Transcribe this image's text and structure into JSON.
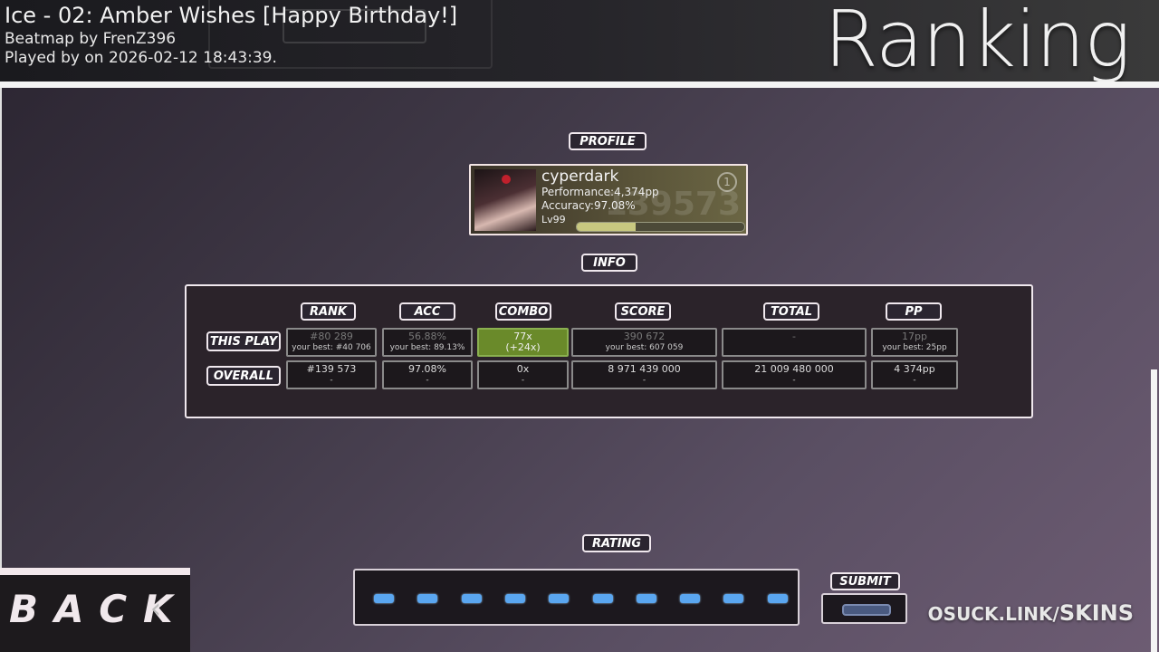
{
  "header": {
    "song_title": "Ice - 02: Amber Wishes [Happy Birthday!]",
    "beatmap_by": "Beatmap by FrenZ396",
    "played_by": "Played by  on 2026-02-12 18:43:39.",
    "screen_title": "Ranking"
  },
  "sections": {
    "profile": "PROFILE",
    "info": "INFO",
    "rating": "RATING",
    "submit": "SUBMIT"
  },
  "profile": {
    "username": "cyperdark",
    "performance": "Performance:4,374pp",
    "accuracy": "Accuracy:97.08%",
    "level": "Lv99",
    "level_progress": 0.35,
    "global_rank_bg": "139573",
    "country_rank": "1"
  },
  "info": {
    "columns": [
      "RANK",
      "ACC",
      "COMBO",
      "SCORE",
      "TOTAL",
      "PP"
    ],
    "rows": [
      "THIS PLAY",
      "OVERALL"
    ],
    "this_play": {
      "rank": {
        "main": "#80 289",
        "sub": "your best: #40 706"
      },
      "acc": {
        "main": "56.88%",
        "sub": "your best: 89.13%"
      },
      "combo": {
        "main": "77x",
        "sub": "(+24x)"
      },
      "score": {
        "main": "390 672",
        "sub": "your best: 607 059"
      },
      "total": {
        "main": "-",
        "sub": ""
      },
      "pp": {
        "main": "17pp",
        "sub": "your best: 25pp"
      }
    },
    "overall": {
      "rank": {
        "main": "#139 573",
        "sub": "-"
      },
      "acc": {
        "main": "97.08%",
        "sub": "-"
      },
      "combo": {
        "main": "0x",
        "sub": "-"
      },
      "score": {
        "main": "8 971 439 000",
        "sub": "-"
      },
      "total": {
        "main": "21 009 480 000",
        "sub": "-"
      },
      "pp": {
        "main": "4 374pp",
        "sub": "-"
      }
    }
  },
  "rating": {
    "dot_count": 10
  },
  "back_label": "BACK",
  "watermark": {
    "prefix": "OSUCK.LINK/",
    "suffix": "SKINS"
  },
  "colors": {
    "accent_blue": "#5aa6f0",
    "combo_green": "#6a8a2a"
  }
}
